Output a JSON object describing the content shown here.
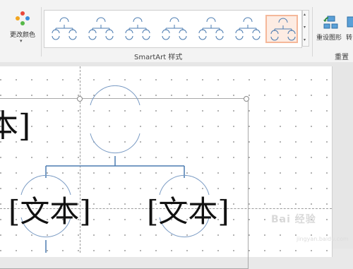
{
  "ribbon": {
    "change_colors_label": "更改颜色",
    "change_colors_arrow": "▾",
    "smartart_styles_label": "SmartArt 样式",
    "reset_graphic_label": "重设图形",
    "convert_label": "转",
    "reset_group_label": "重置",
    "gallery_scroll_up": "▴",
    "gallery_scroll_down": "▾",
    "gallery_more": "▾",
    "style_count": 7,
    "selected_style_index": 6,
    "selection_color": "#f5b89a"
  },
  "diagram": {
    "top_partial_text": "本]",
    "left_text": "[文本]",
    "right_text": "[文本]",
    "line_color": "#7a9bc4"
  },
  "watermark": {
    "text": "Bai 经验",
    "sub": "jingyan.baidu.com"
  }
}
